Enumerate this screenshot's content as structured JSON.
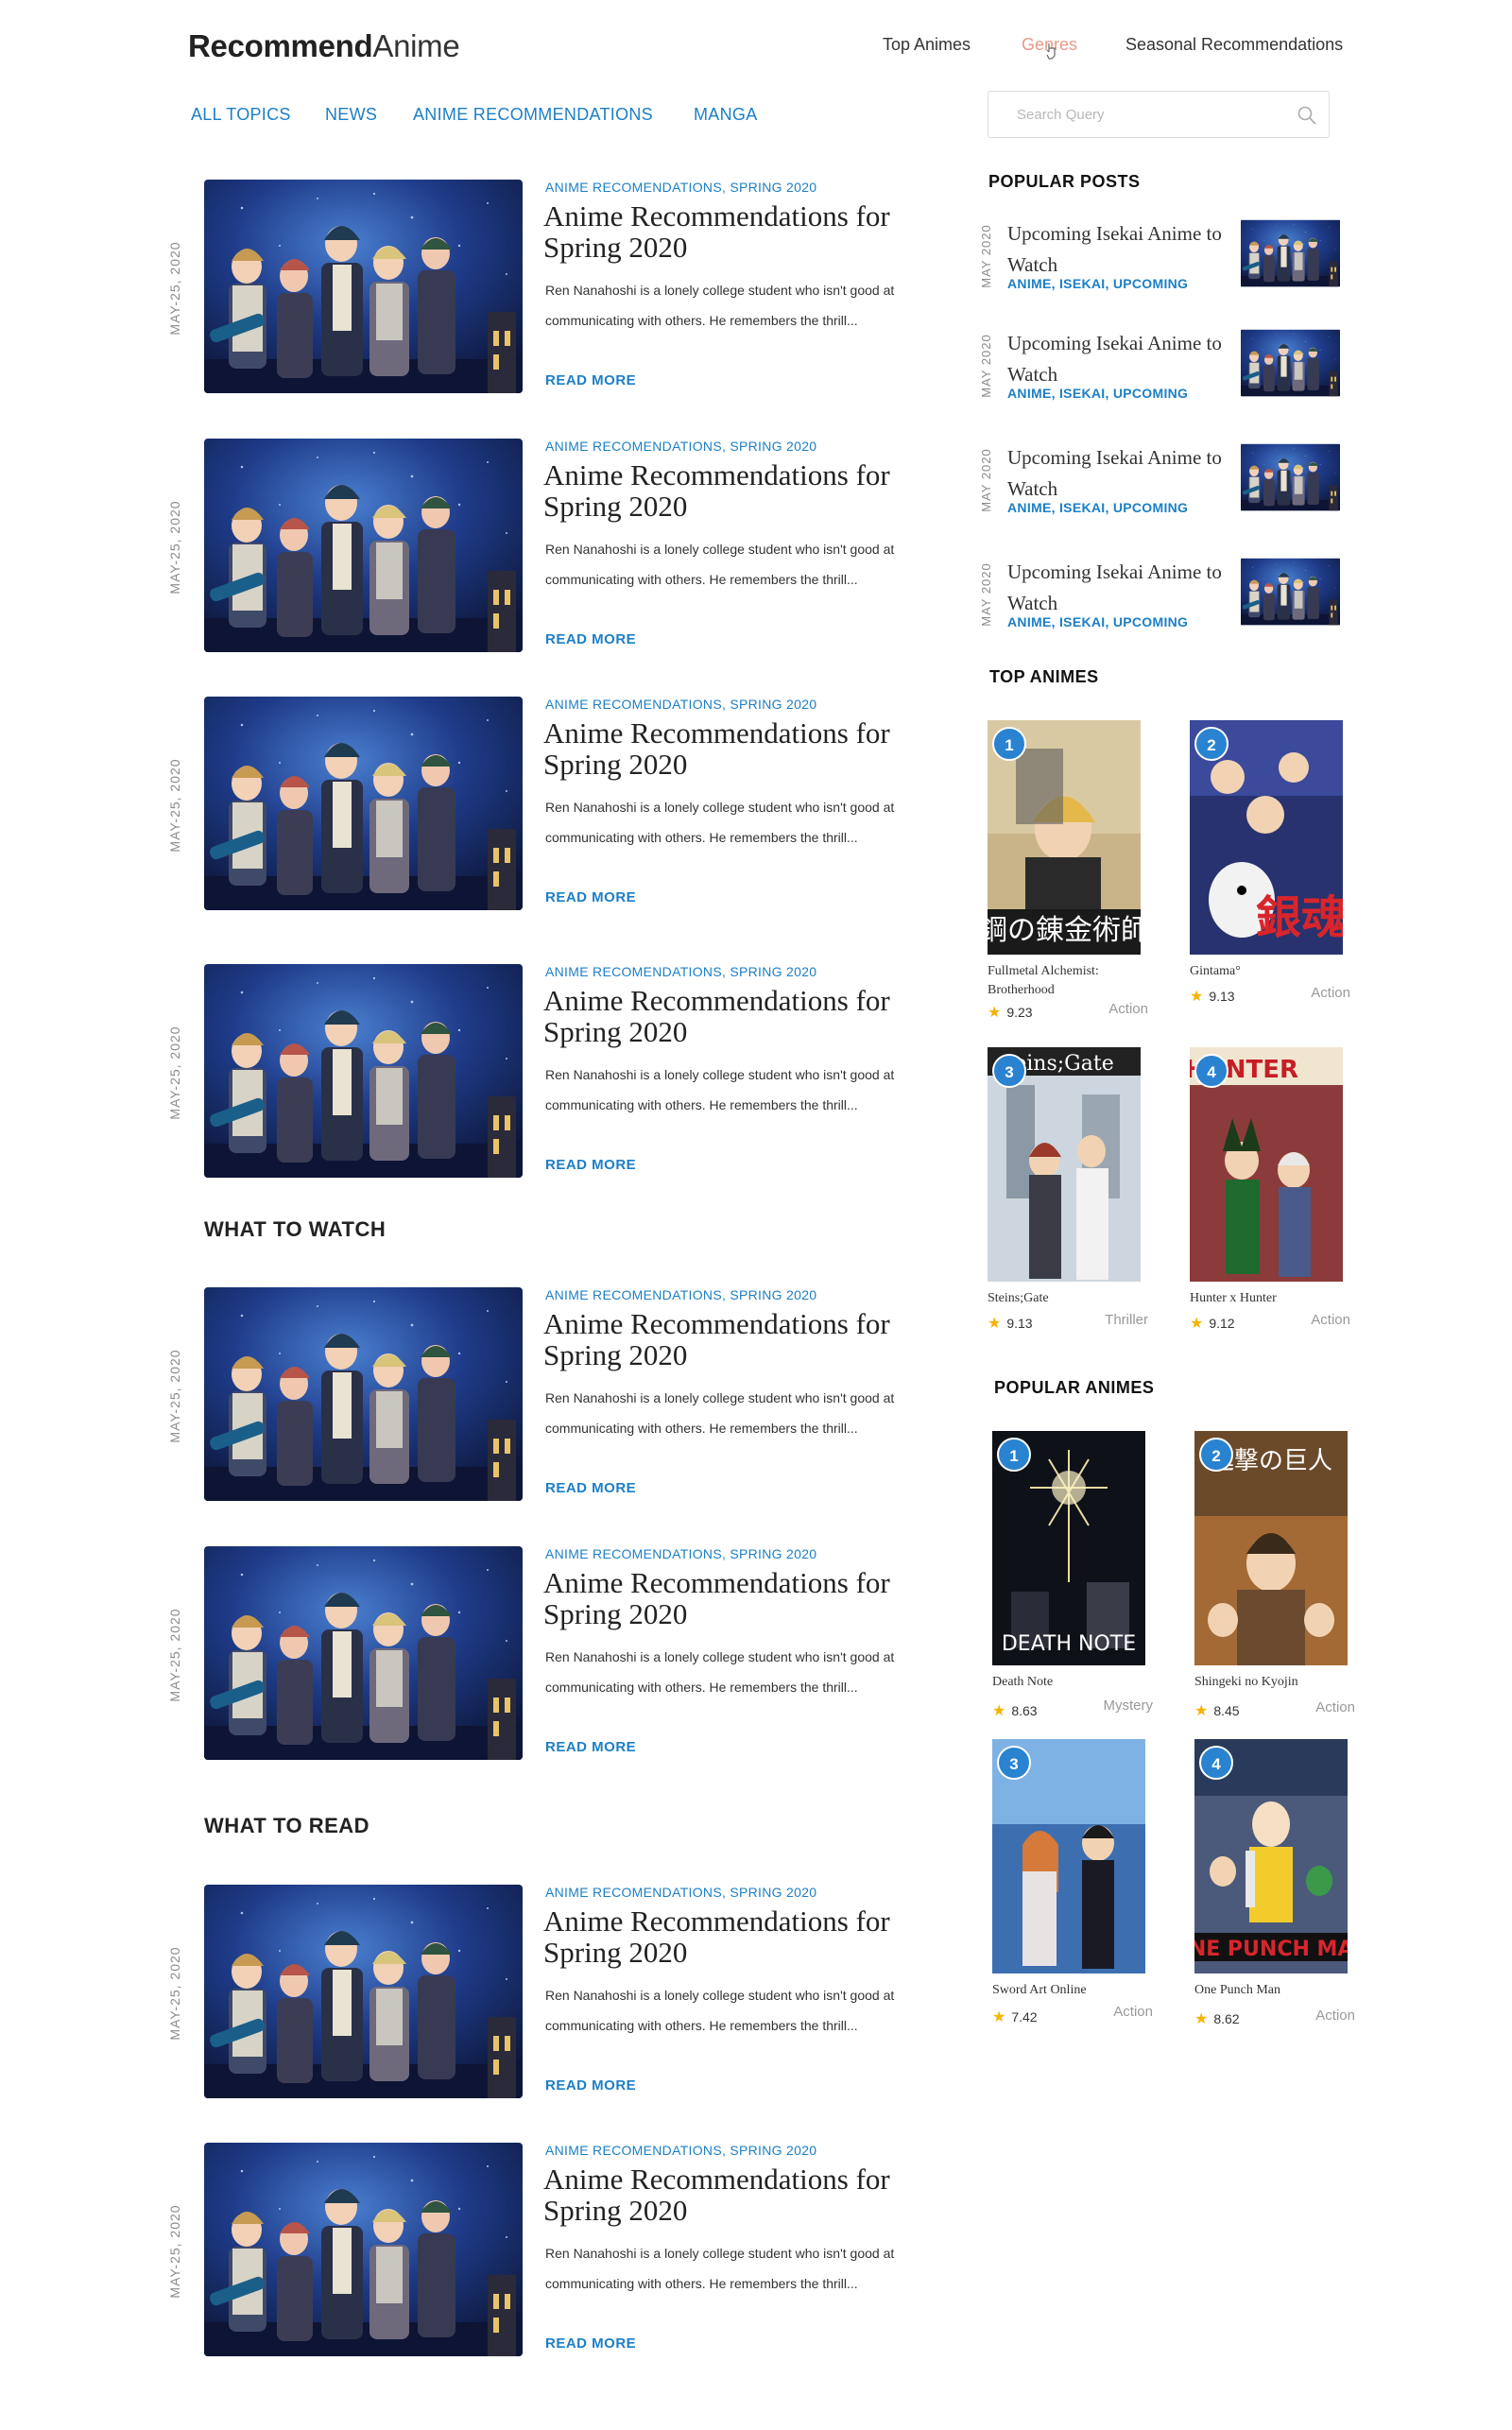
{
  "header": {
    "logo_bold": "Recommend",
    "logo_light": "Anime",
    "nav": [
      "Top Animes",
      "Genres",
      "Seasonal Recommendations"
    ]
  },
  "categories": [
    "ALL TOPICS",
    "NEWS",
    "ANIME RECOMMENDATIONS",
    "MANGA"
  ],
  "search": {
    "placeholder": "Search Query"
  },
  "article": {
    "date": "MAY-25, 2020",
    "cats": "ANIME RECOMENDATIONS, SPRING 2020",
    "title": "Anime Recommendations for Spring 2020",
    "excerpt": "Ren Nanahoshi is a lonely college student who isn't good at communicating with others. He remembers the thrill...",
    "more": "READ MORE"
  },
  "sections": {
    "what_to_watch": "WHAT TO WATCH",
    "what_to_read": "WHAT TO READ"
  },
  "sidebar": {
    "popular_posts_title": "POPULAR POSTS",
    "popular_post": {
      "date": "MAY 2020",
      "title": "Upcoming Isekai Anime to Watch",
      "tags": "ANIME, ISEKAI, UPCOMING"
    },
    "top_animes_title": "TOP ANIMES",
    "top_animes": [
      {
        "rank": "1",
        "name": "Fullmetal Alchemist: Brotherhood",
        "score": "9.23",
        "genre": "Action"
      },
      {
        "rank": "2",
        "name": "Gintama°",
        "score": "9.13",
        "genre": "Action"
      },
      {
        "rank": "3",
        "name": "Steins;Gate",
        "score": "9.13",
        "genre": "Thriller"
      },
      {
        "rank": "4",
        "name": "Hunter x Hunter",
        "score": "9.12",
        "genre": "Action"
      }
    ],
    "popular_animes_title": "POPULAR ANIMES",
    "popular_animes": [
      {
        "rank": "1",
        "name": "Death Note",
        "score": "8.63",
        "genre": "Mystery"
      },
      {
        "rank": "2",
        "name": "Shingeki no Kyojin",
        "score": "8.45",
        "genre": "Action"
      },
      {
        "rank": "3",
        "name": "Sword Art Online",
        "score": "7.42",
        "genre": "Action"
      },
      {
        "rank": "4",
        "name": "One Punch Man",
        "score": "8.62",
        "genre": "Action"
      }
    ]
  }
}
